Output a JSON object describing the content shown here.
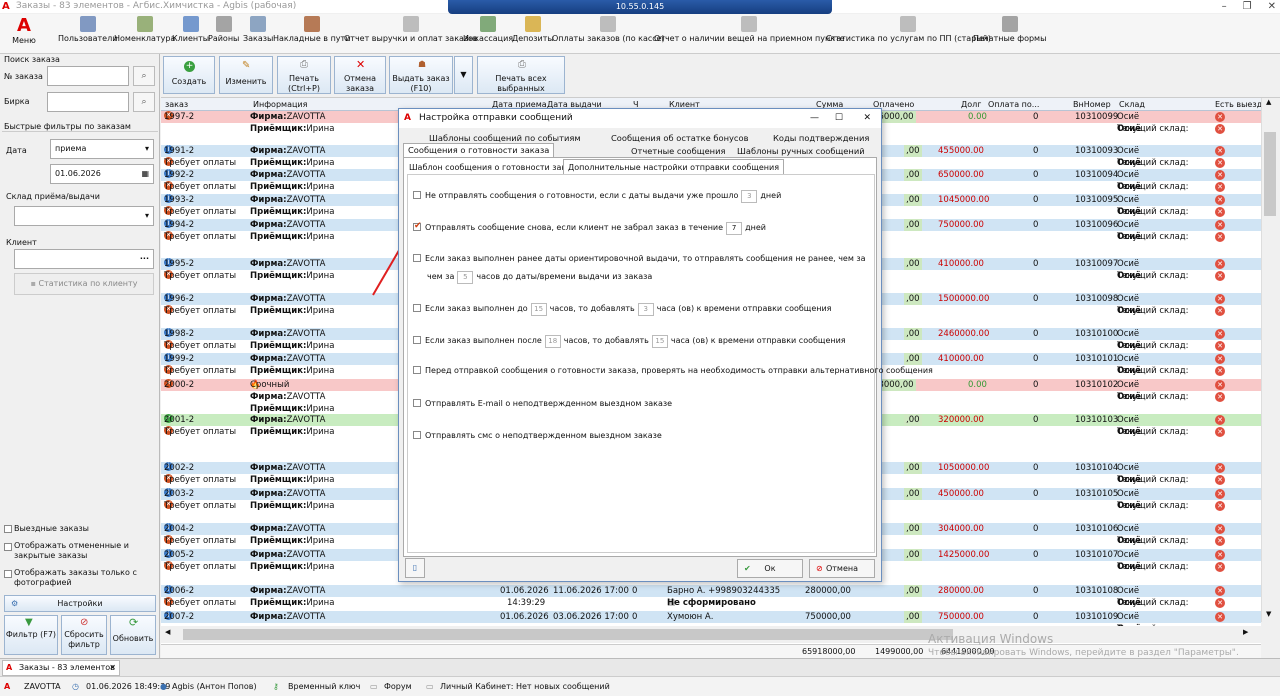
{
  "window": {
    "title": "Заказы - 83 элементов - Агбис.Химчистка - Agbis (рабочая)",
    "rdp_ip": "10.55.0.145",
    "controls": [
      "–",
      "❐",
      "✕"
    ]
  },
  "toolbar": {
    "menu": "Меню",
    "items": [
      {
        "label": "Пользователи",
        "icon": "users-icon",
        "color": "#5a7ab0"
      },
      {
        "label": "Номенклатура",
        "icon": "catalog-icon",
        "color": "#7a9a50"
      },
      {
        "label": "Клиенты",
        "icon": "client-icon",
        "color": "#4a7ac0"
      },
      {
        "label": "Районы",
        "icon": "map-icon",
        "color": "#888888"
      },
      {
        "label": "Заказы",
        "icon": "orders-icon",
        "color": "#6a8ab0"
      },
      {
        "label": "Накладные в пути",
        "icon": "truck-icon",
        "color": "#a05020"
      },
      {
        "label": "Отчет выручки и оплат заказов",
        "icon": "report-icon",
        "color": "#aaaaaa"
      },
      {
        "label": "Инкассация",
        "icon": "money-icon",
        "color": "#5a9050"
      },
      {
        "label": "Депозиты",
        "icon": "deposit-icon",
        "color": "#d0a020"
      },
      {
        "label": "Оплаты заказов (по кассе)",
        "icon": "report-icon",
        "color": "#aaaaaa"
      },
      {
        "label": "Отчет о наличии вещей на приемном пункте",
        "icon": "report-icon",
        "color": "#aaaaaa"
      },
      {
        "label": "Статистика по услугам по ПП (старый)",
        "icon": "report-icon",
        "color": "#aaaaaa"
      },
      {
        "label": "Печатные формы",
        "icon": "printer-icon",
        "color": "#888888"
      }
    ]
  },
  "left": {
    "search_title": "Поиск заказа",
    "order_no": "№ заказа",
    "tag": "Бирка",
    "quick_filters": "Быстрые фильтры по заказам",
    "date": "Дата",
    "date_type": "приема",
    "date_value": "01.06.2026",
    "warehouse": "Склад приёма/выдачи",
    "client": "Клиент",
    "client_stats": "Статистика по клиенту",
    "chk_outgoing": "Выездные заказы",
    "chk_cancelled": "Отображать отмененные и закрытые заказы",
    "chk_photos": "Отображать заказы только с фотографией",
    "settings": "Настройки",
    "filter": "Фильтр (F7)",
    "reset": "Сбросить фильтр",
    "refresh": "Обновить"
  },
  "actions": {
    "create": "Создать",
    "edit": "Изменить",
    "print": "Печать (Ctrl+P)",
    "cancel": "Отмена заказа",
    "issue": "Выдать заказ (F10)",
    "print_all": "Печать всех выбранных"
  },
  "columns": [
    "заказ",
    "Информация",
    "Дата приема",
    "Дата выдачи",
    "Ч",
    "Клиент",
    "Сумма",
    "Оплачено",
    "Долг",
    "Оплата по...",
    "ВнНомер",
    "Склад",
    "Есть выезд",
    "Вы"
  ],
  "rows": [
    {
      "id": "1997-2",
      "status": "x",
      "info1_k": "Фирма:",
      "info1_v": "ZAVOTTA",
      "info2_k": "Приёмщик:",
      "info2_v": "Ирина",
      "paid": "36000,00",
      "debt": "0.00",
      "op": "0",
      "inner": "10310099",
      "wh": "Осиё",
      "bg": "#f8c8c8",
      "dcol": "green"
    },
    {
      "id": "1991-2",
      "status": "i",
      "sub": "Требует оплаты",
      "info1_k": "Фирма:",
      "info1_v": "ZAVOTTA",
      "info2_k": "Приёмщик:",
      "info2_v": "Ирина",
      "paid": ",00",
      "debt": "455000.00",
      "op": "0",
      "inner": "10310093",
      "wh": "Осиё",
      "bg": "#d0e4f4",
      "dcol": "red"
    },
    {
      "id": "1992-2",
      "status": "i",
      "sub": "Требует оплаты",
      "info1_k": "Фирма:",
      "info1_v": "ZAVOTTA",
      "info2_k": "Приёмщик:",
      "info2_v": "Ирина",
      "paid": ",00",
      "debt": "650000.00",
      "op": "0",
      "inner": "10310094",
      "wh": "Осиё",
      "bg": "#d0e4f4",
      "dcol": "red"
    },
    {
      "id": "1993-2",
      "status": "i",
      "sub": "Требует оплаты",
      "info1_k": "Фирма:",
      "info1_v": "ZAVOTTA",
      "info2_k": "Приёмщик:",
      "info2_v": "Ирина",
      "paid": ",00",
      "debt": "1045000.00",
      "op": "0",
      "inner": "10310095",
      "wh": "Осиё",
      "bg": "#d0e4f4",
      "dcol": "red"
    },
    {
      "id": "1994-2",
      "status": "i",
      "sub": "Требует оплаты",
      "info1_k": "Фирма:",
      "info1_v": "ZAVOTTA",
      "info2_k": "Приёмщик:",
      "info2_v": "Ирина",
      "paid": ",00",
      "debt": "750000.00",
      "op": "0",
      "inner": "10310096",
      "wh": "Осиё",
      "bg": "#d0e4f4",
      "dcol": "red"
    },
    {
      "id": "1995-2",
      "status": "i",
      "sub": "Требует оплаты",
      "info1_k": "Фирма:",
      "info1_v": "ZAVOTTA",
      "info2_k": "Приёмщик:",
      "info2_v": "Ирина",
      "paid": ",00",
      "debt": "410000.00",
      "op": "0",
      "inner": "10310097",
      "wh": "Осиё",
      "bg": "#d0e4f4",
      "dcol": "red"
    },
    {
      "id": "1996-2",
      "status": "i",
      "sub": "Требует оплаты",
      "info1_k": "Фирма:",
      "info1_v": "ZAVOTTA",
      "info2_k": "Приёмщик:",
      "info2_v": "Ирина",
      "paid": ",00",
      "debt": "1500000.00",
      "op": "0",
      "inner": "10310098",
      "wh": "Осиё",
      "bg": "#d0e4f4",
      "dcol": "red"
    },
    {
      "id": "1998-2",
      "status": "i",
      "sub": "Требует оплаты",
      "info1_k": "Фирма:",
      "info1_v": "ZAVOTTA",
      "info2_k": "Приёмщик:",
      "info2_v": "Ирина",
      "paid": ",00",
      "debt": "2460000.00",
      "op": "0",
      "inner": "10310100",
      "wh": "Осиё",
      "bg": "#d0e4f4",
      "dcol": "red"
    },
    {
      "id": "1999-2",
      "status": "i",
      "sub": "Требует оплаты",
      "info1_k": "Фирма:",
      "info1_v": "ZAVOTTA",
      "info2_k": "Приёмщик:",
      "info2_v": "Ирина",
      "paid": ",00",
      "debt": "410000.00",
      "op": "0",
      "inner": "10310101",
      "wh": "Осиё",
      "bg": "#d0e4f4",
      "dcol": "red"
    },
    {
      "id": "2000-2",
      "status": "x",
      "urgent": "Срочный",
      "info1_k": "Фирма:",
      "info1_v": "ZAVOTTA",
      "info2_k": "Приёмщик:",
      "info2_v": "Ирина",
      "paid": "08000,00",
      "debt": "0.00",
      "op": "0",
      "inner": "10310102",
      "wh": "Осиё",
      "bg": "#f8c8c8",
      "dcol": "green"
    },
    {
      "id": "2001-2",
      "status": "g",
      "sub": "Требует оплаты",
      "info1_k": "Фирма:",
      "info1_v": "ZAVOTTA",
      "info2_k": "Приёмщик:",
      "info2_v": "Ирина",
      "paid": ",00",
      "debt": "320000.00",
      "op": "0",
      "inner": "10310103",
      "wh": "Осиё",
      "bg": "#c8ecc0",
      "dcol": "red"
    },
    {
      "id": "2002-2",
      "status": "i",
      "sub": "Требует оплаты",
      "info1_k": "Фирма:",
      "info1_v": "ZAVOTTA",
      "info2_k": "Приёмщик:",
      "info2_v": "Ирина",
      "paid": ",00",
      "debt": "1050000.00",
      "op": "0",
      "inner": "10310104",
      "wh": "Осиё",
      "bg": "#d0e4f4",
      "dcol": "red"
    },
    {
      "id": "2003-2",
      "status": "i",
      "sub": "Требует оплаты",
      "info1_k": "Фирма:",
      "info1_v": "ZAVOTTA",
      "info2_k": "Приёмщик:",
      "info2_v": "Ирина",
      "paid": ",00",
      "debt": "450000.00",
      "op": "0",
      "inner": "10310105",
      "wh": "Осиё",
      "bg": "#d0e4f4",
      "dcol": "red"
    },
    {
      "id": "2004-2",
      "status": "i",
      "sub": "Требует оплаты",
      "info1_k": "Фирма:",
      "info1_v": "ZAVOTTA",
      "info2_k": "Приёмщик:",
      "info2_v": "Ирина",
      "paid": ",00",
      "debt": "304000.00",
      "op": "0",
      "inner": "10310106",
      "wh": "Осиё",
      "bg": "#d0e4f4",
      "dcol": "red"
    },
    {
      "id": "2005-2",
      "status": "i",
      "sub": "Требует оплаты",
      "info1_k": "Фирма:",
      "info1_v": "ZAVOTTA",
      "info2_k": "Приёмщик:",
      "info2_v": "Ирина",
      "paid": ",00",
      "debt": "1425000.00",
      "op": "0",
      "inner": "10310107",
      "wh": "Осиё",
      "bg": "#d0e4f4",
      "dcol": "red"
    },
    {
      "id": "2006-2",
      "status": "i",
      "sub": "Требует оплаты",
      "info1_k": "Фирма:",
      "info1_v": "ZAVOTTA",
      "info2_k": "Приёмщик:",
      "info2_v": "Ирина",
      "recv": "01.06.2026",
      "recv_t": "14:39:29",
      "give": "11.06.2026 17:00",
      "ch": "0",
      "client": "Барно А. +998903244335",
      "client2": "Не сформировано",
      "sum": "280000,00",
      "paid": ",00",
      "debt": "280000.00",
      "op": "0",
      "inner": "10310108",
      "wh": "Осиё",
      "bg": "#d0e4f4",
      "dcol": "red"
    },
    {
      "id": "2007-2",
      "status": "i",
      "info1_k": "Фирма:",
      "info1_v": "ZAVOTTA",
      "recv": "01.06.2026",
      "give": "03.06.2026 17:00",
      "ch": "0",
      "client": "Хумоюн А.",
      "sum": "750000,00",
      "paid": ",00",
      "debt": "750000.00",
      "op": "0",
      "inner": "10310109",
      "wh": "Осиё",
      "bg": "#d0e4f4",
      "dcol": "red"
    }
  ],
  "row_wh_label": "Текущий склад:",
  "totals": {
    "sum": "65918000,00",
    "paid": "1499000,00",
    "debt": "64419000,00"
  },
  "tab": {
    "label": "Заказы - 83 элементов"
  },
  "status": {
    "company": "ZAVOTTA",
    "datetime": "01.06.2026 18:49:39",
    "user": "Agbis (Антон Попов)",
    "key": "Временный ключ",
    "forum": "Форум",
    "cabinet": "Личный Кабинет: Нет новых сообщений"
  },
  "watermark": {
    "title": "Активация Windows",
    "text": "Чтобы активировать Windows, перейдите в раздел \"Параметры\"."
  },
  "dialog": {
    "title": "Настройка отправки сообщений",
    "tabs_row1": [
      "Шаблоны сообщений по событиям",
      "Сообщения об остатке бонусов",
      "Коды подтверждения"
    ],
    "tabs_row2": [
      "Сообщения о готовности заказа",
      "Отчетные сообщения",
      "Шаблоны ручных сообщений"
    ],
    "subtabs": [
      "Шаблон сообщения о готовности заказа",
      "Дополнительные настройки отправки сообщения"
    ],
    "opt1_a": "Не отправлять сообщения о готовности, если с даты выдачи уже прошло",
    "opt1_n": "3",
    "opt1_b": "дней",
    "opt2_a": "Отправлять сообщение снова, если клиент не забрал заказ в течение",
    "opt2_n": "7",
    "opt2_b": "дней",
    "opt3_a": "Если заказ выполнен ранее даты ориентировочной выдачи, то отправлять сообщения не ранее, чем за",
    "opt3_pre": "чем за",
    "opt3_n": "5",
    "opt3_b": "часов до даты/времени выдачи из заказа",
    "opt4_a": "Если заказ выполнен до",
    "opt4_n1": "15",
    "opt4_m": "часов, то добавлять",
    "opt4_n2": "3",
    "opt4_b": "часа (ов) к времени отправки сообщения",
    "opt5_a": "Если заказ выполнен после",
    "opt5_n1": "18",
    "opt5_m": "часов, то добавлять",
    "opt5_n2": "15",
    "opt5_b": "часа (ов) к времени отправки сообщения",
    "opt6": "Перед отправкой сообщения о готовности заказа, проверять на необходимость отправки альтернативного сообщения",
    "opt7": "Отправлять E-mail о неподтвержденном выездном заказе",
    "opt8": "Отправлять смс о неподтвержденном выездном заказе",
    "ok": "Ок",
    "cancel": "Отмена"
  }
}
